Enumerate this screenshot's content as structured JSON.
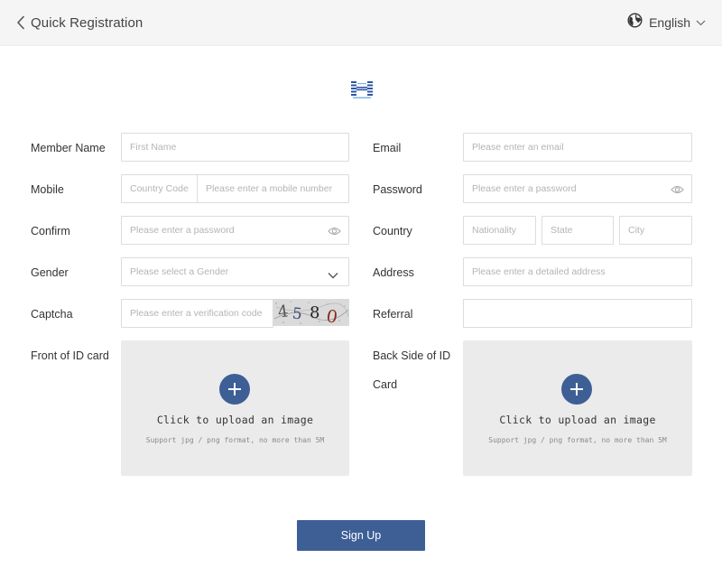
{
  "header": {
    "title": "Quick Registration",
    "language": "English"
  },
  "form": {
    "member_name": {
      "label": "Member Name",
      "placeholder": "First Name"
    },
    "mobile": {
      "label": "Mobile",
      "country_code_placeholder": "Country Code",
      "placeholder": "Please enter a mobile number"
    },
    "confirm": {
      "label": "Confirm",
      "placeholder": "Please enter a password"
    },
    "gender": {
      "label": "Gender",
      "placeholder": "Please select a Gender"
    },
    "captcha": {
      "label": "Captcha",
      "placeholder": "Please enter a verification code",
      "code": "4580"
    },
    "front_id": {
      "label": "Front of ID card"
    },
    "email": {
      "label": "Email",
      "placeholder": "Please enter an email"
    },
    "password": {
      "label": "Password",
      "placeholder": "Please enter a password"
    },
    "country": {
      "label": "Country",
      "nationality_placeholder": "Nationality",
      "state_placeholder": "State",
      "city_placeholder": "City"
    },
    "address": {
      "label": "Address",
      "placeholder": "Please enter a detailed address"
    },
    "referral": {
      "label": "Referral",
      "placeholder": ""
    },
    "back_id": {
      "label_line1": "Back Side of ID",
      "label_line2": "Card"
    }
  },
  "upload": {
    "title": "Click to upload an image",
    "hint": "Support jpg / png format, no more than 5M"
  },
  "submit_label": "Sign Up",
  "colors": {
    "accent": "#3d5f96",
    "header_bg": "#f5f5f5",
    "upload_bg": "#ebebeb",
    "border": "#dcdcdc"
  },
  "icons": [
    "chevron-left-icon",
    "globe-icon",
    "chevron-down-icon",
    "logo-icon",
    "eye-icon",
    "plus-icon"
  ]
}
